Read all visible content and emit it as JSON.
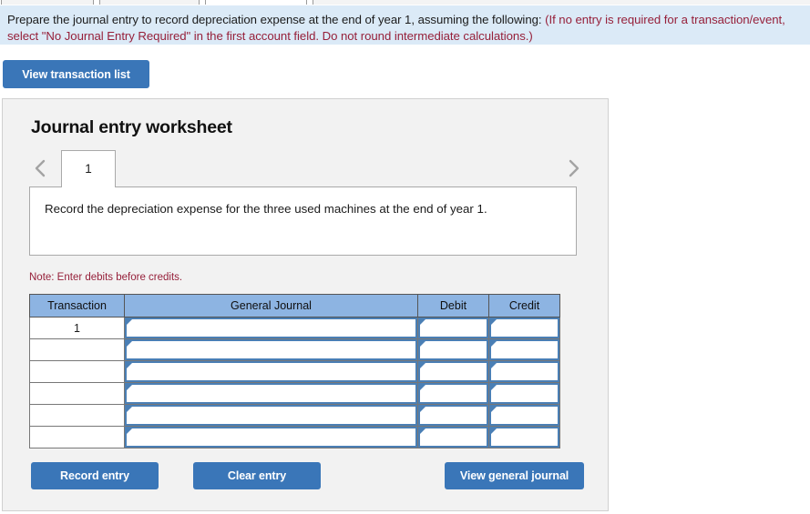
{
  "instruction": {
    "black_text": "Prepare the journal entry to record depreciation expense at the end of year 1, assuming the following: ",
    "red_text": "(If no entry is required for a transaction/event, select \"No Journal Entry Required\" in the first account field. Do not round intermediate calculations.)"
  },
  "toolbar": {
    "view_transaction_list_label": "View transaction list"
  },
  "worksheet": {
    "title": "Journal entry worksheet",
    "prev_icon": "chevron-left-icon",
    "next_icon": "chevron-right-icon",
    "tabs": [
      {
        "label": "1",
        "active": true
      }
    ],
    "prompt": "Record the depreciation expense for the three used machines at the end of year 1.",
    "note": "Note: Enter debits before credits."
  },
  "journal_table": {
    "columns": [
      "Transaction",
      "General Journal",
      "Debit",
      "Credit"
    ],
    "rows": [
      {
        "transaction": "1",
        "general_journal": "",
        "debit": "",
        "credit": ""
      },
      {
        "transaction": "",
        "general_journal": "",
        "debit": "",
        "credit": ""
      },
      {
        "transaction": "",
        "general_journal": "",
        "debit": "",
        "credit": ""
      },
      {
        "transaction": "",
        "general_journal": "",
        "debit": "",
        "credit": ""
      },
      {
        "transaction": "",
        "general_journal": "",
        "debit": "",
        "credit": ""
      },
      {
        "transaction": "",
        "general_journal": "",
        "debit": "",
        "credit": ""
      }
    ]
  },
  "actions": {
    "record_entry_label": "Record entry",
    "clear_entry_label": "Clear entry",
    "view_general_journal_label": "View general journal"
  },
  "colors": {
    "banner_background": "#dbeaf7",
    "accent_blue": "#3a76b8",
    "table_header_blue": "#8db4e2",
    "note_red": "#96203a",
    "panel_background": "#f2f2f2",
    "input_border_blue": "#4a7fb5"
  }
}
